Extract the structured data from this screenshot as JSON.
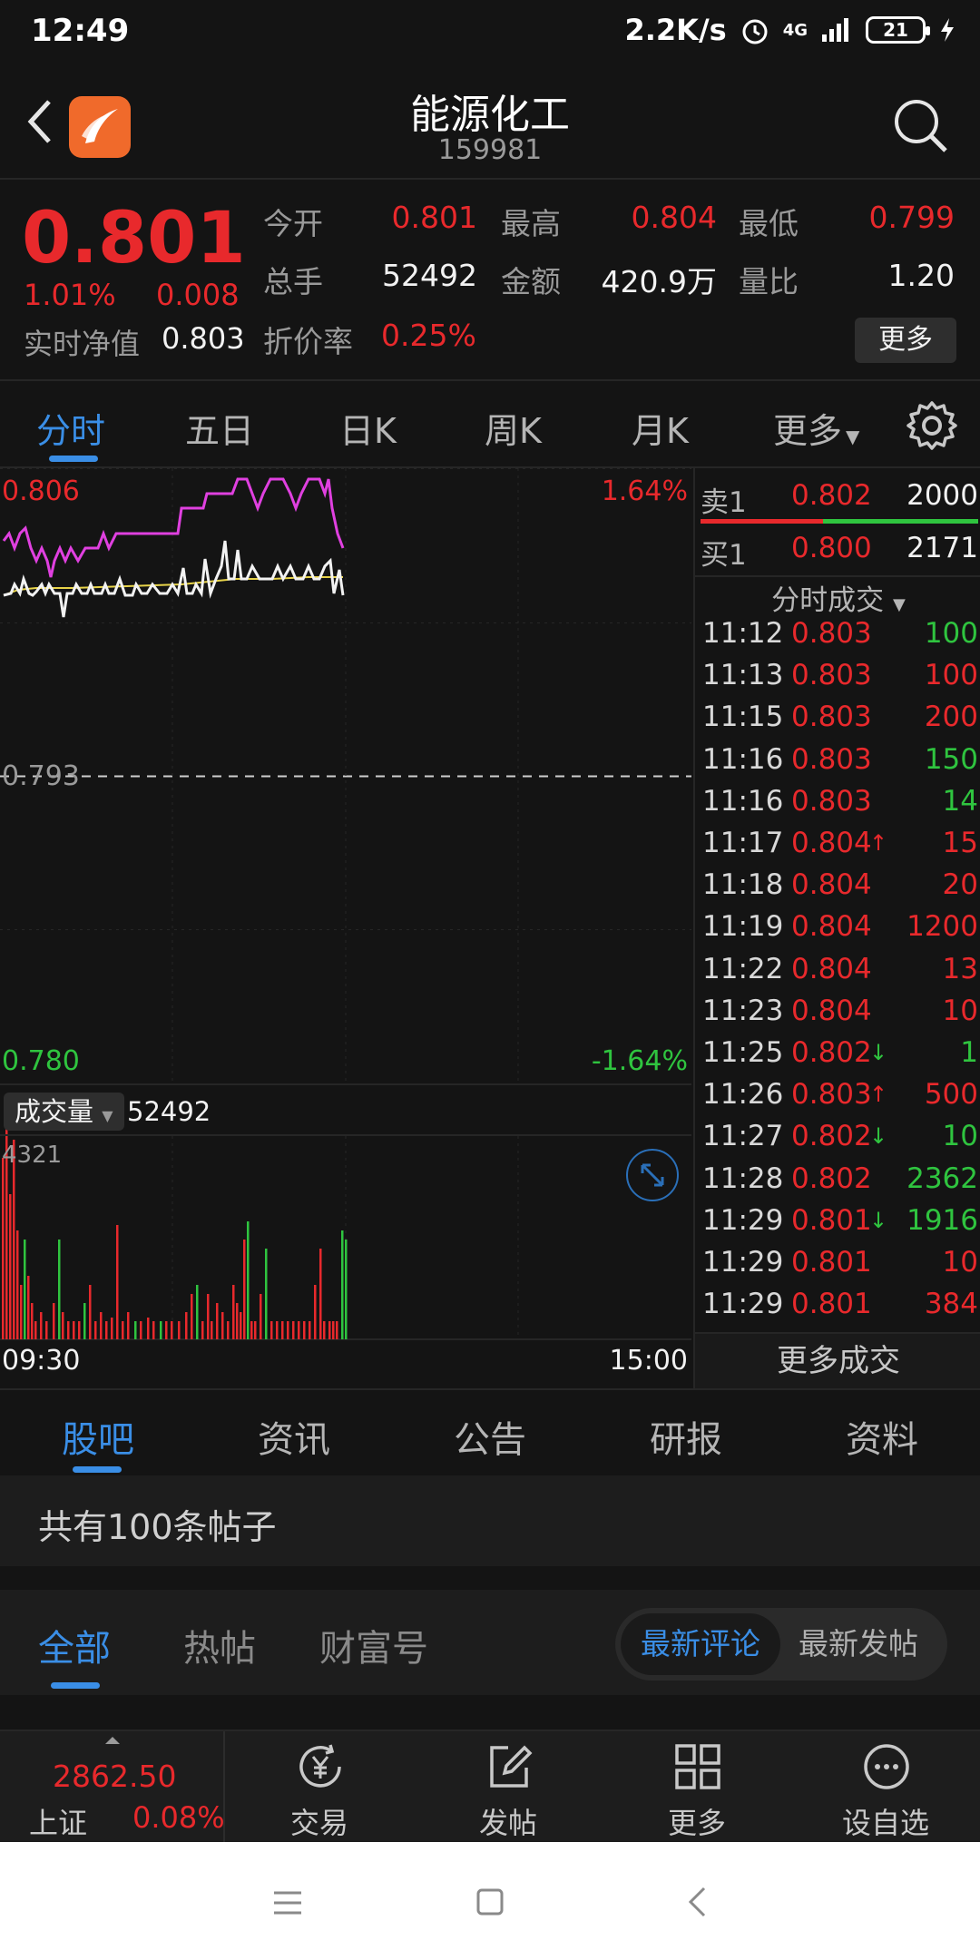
{
  "status": {
    "time": "12:49",
    "speed": "2.2K/s",
    "network": "4G",
    "battery": "21"
  },
  "header": {
    "title": "能源化工",
    "code": "159981"
  },
  "quote": {
    "price": "0.801",
    "pct": "1.01%",
    "change": "0.008",
    "nav_label": "实时净值",
    "nav_value": "0.803",
    "open_label": "今开",
    "open": "0.801",
    "high_label": "最高",
    "high": "0.804",
    "low_label": "最低",
    "low": "0.799",
    "vol_label": "总手",
    "vol": "52492",
    "amount_label": "金额",
    "amount": "420.9万",
    "ratio_label": "量比",
    "ratio": "1.20",
    "discount_label": "折价率",
    "discount": "0.25%",
    "more": "更多"
  },
  "chart_tabs": [
    "分时",
    "五日",
    "日K",
    "周K",
    "月K",
    "更多"
  ],
  "chart": {
    "top_price": "0.806",
    "top_pct": "1.64%",
    "mid_price": "0.793",
    "bottom_price": "0.780",
    "bottom_pct": "-1.64%",
    "vol_tag": "成交量",
    "vol_total": "52492",
    "vol_max": "4321",
    "time_start": "09:30",
    "time_end": "15:00"
  },
  "chart_data": {
    "type": "line",
    "x_range": [
      "09:30",
      "15:00"
    ],
    "ylim": [
      0.78,
      0.806
    ],
    "y_ref": 0.793,
    "volume_max": 4321
  },
  "book": {
    "sell_label": "卖1",
    "sell_price": "0.802",
    "sell_vol": "2000",
    "buy_label": "买1",
    "buy_price": "0.800",
    "buy_vol": "2171",
    "ticks_header": "分时成交",
    "more_ticks": "更多成交"
  },
  "ticks": [
    {
      "t": "11:12",
      "p": "0.803",
      "a": "",
      "v": "100",
      "c": "green"
    },
    {
      "t": "11:13",
      "p": "0.803",
      "a": "",
      "v": "100",
      "c": "red"
    },
    {
      "t": "11:15",
      "p": "0.803",
      "a": "",
      "v": "200",
      "c": "red"
    },
    {
      "t": "11:16",
      "p": "0.803",
      "a": "",
      "v": "150",
      "c": "green"
    },
    {
      "t": "11:16",
      "p": "0.803",
      "a": "",
      "v": "14",
      "c": "green"
    },
    {
      "t": "11:17",
      "p": "0.804",
      "a": "↑",
      "v": "15",
      "c": "red"
    },
    {
      "t": "11:18",
      "p": "0.804",
      "a": "",
      "v": "20",
      "c": "red"
    },
    {
      "t": "11:19",
      "p": "0.804",
      "a": "",
      "v": "1200",
      "c": "red"
    },
    {
      "t": "11:22",
      "p": "0.804",
      "a": "",
      "v": "13",
      "c": "red"
    },
    {
      "t": "11:23",
      "p": "0.804",
      "a": "",
      "v": "10",
      "c": "red"
    },
    {
      "t": "11:25",
      "p": "0.802",
      "a": "↓",
      "v": "1",
      "c": "green"
    },
    {
      "t": "11:26",
      "p": "0.803",
      "a": "↑",
      "v": "500",
      "c": "red"
    },
    {
      "t": "11:27",
      "p": "0.802",
      "a": "↓",
      "v": "10",
      "c": "green"
    },
    {
      "t": "11:28",
      "p": "0.802",
      "a": "",
      "v": "2362",
      "c": "green"
    },
    {
      "t": "11:29",
      "p": "0.801",
      "a": "↓",
      "v": "1916",
      "c": "green"
    },
    {
      "t": "11:29",
      "p": "0.801",
      "a": "",
      "v": "10",
      "c": "red"
    },
    {
      "t": "11:29",
      "p": "0.801",
      "a": "",
      "v": "384",
      "c": "red"
    }
  ],
  "bottom_tabs": [
    "股吧",
    "资讯",
    "公告",
    "研报",
    "资料"
  ],
  "posts": {
    "count_text": "共有100条帖子"
  },
  "filter": {
    "tabs": [
      "全部",
      "热帖",
      "财富号"
    ],
    "seg_on": "最新评论",
    "seg_off": "最新发帖"
  },
  "bottom_nav": {
    "index_value": "2862.50",
    "index_name": "上证",
    "index_pct": "0.08%",
    "items": [
      "交易",
      "发帖",
      "更多",
      "设自选"
    ]
  },
  "colors": {
    "up": "#e8292c",
    "down": "#2fc43f",
    "accent": "#3a8ee6",
    "avg_line": "#e8d44a",
    "magenta": "#e040e0"
  }
}
